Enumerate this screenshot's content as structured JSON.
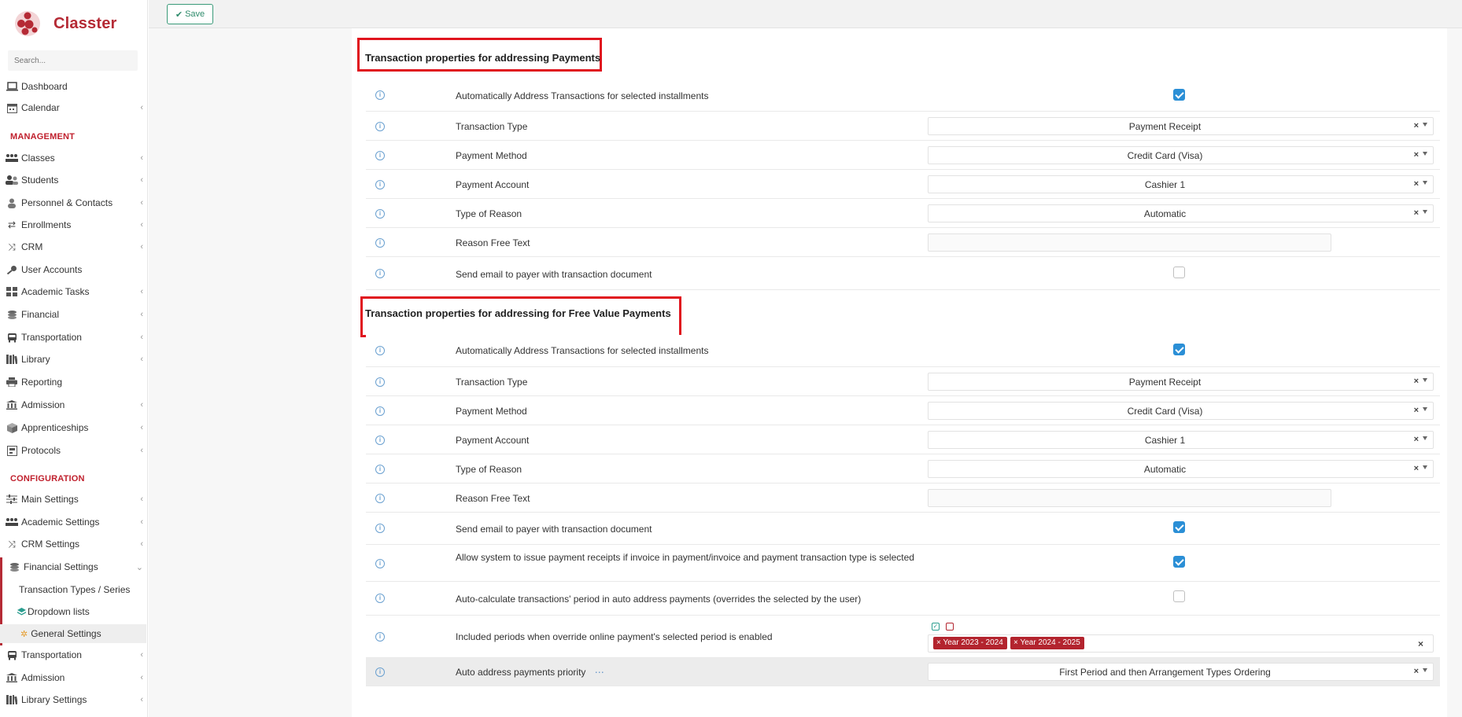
{
  "app": {
    "name": "Classter"
  },
  "sidebar": {
    "search_placeholder": "Search...",
    "items": [
      {
        "label": "Dashboard",
        "icon": "laptop-icon",
        "chevron": false
      },
      {
        "label": "Calendar",
        "icon": "calendar-icon",
        "chevron": true
      }
    ],
    "management_title": "MANAGEMENT",
    "management": [
      {
        "label": "Classes",
        "icon": "classes-icon",
        "chevron": true
      },
      {
        "label": "Students",
        "icon": "users-icon",
        "chevron": true
      },
      {
        "label": "Personnel & Contacts",
        "icon": "user-icon",
        "chevron": true
      },
      {
        "label": "Enrollments",
        "icon": "arrows-icon",
        "chevron": true
      },
      {
        "label": "CRM",
        "icon": "shuffle-icon",
        "chevron": true
      },
      {
        "label": "User Accounts",
        "icon": "key-icon",
        "chevron": false
      },
      {
        "label": "Academic Tasks",
        "icon": "grid-icon",
        "chevron": true
      },
      {
        "label": "Financial",
        "icon": "coins-icon",
        "chevron": true
      },
      {
        "label": "Transportation",
        "icon": "bus-icon",
        "chevron": true
      },
      {
        "label": "Library",
        "icon": "books-icon",
        "chevron": true
      },
      {
        "label": "Reporting",
        "icon": "printer-icon",
        "chevron": false
      },
      {
        "label": "Admission",
        "icon": "bank-icon",
        "chevron": true
      },
      {
        "label": "Apprenticeships",
        "icon": "box-icon",
        "chevron": true
      },
      {
        "label": "Protocols",
        "icon": "archive-icon",
        "chevron": true
      }
    ],
    "configuration_title": "CONFIGURATION",
    "configuration": [
      {
        "label": "Main Settings",
        "icon": "sliders-icon",
        "chevron": true
      },
      {
        "label": "Academic Settings",
        "icon": "classes-icon",
        "chevron": true
      },
      {
        "label": "CRM Settings",
        "icon": "shuffle-icon",
        "chevron": true
      },
      {
        "label": "Financial Settings",
        "icon": "coins-icon",
        "chevron": true
      }
    ],
    "financial_sub": [
      {
        "label": "Transaction Types / Series"
      },
      {
        "label": "Dropdown lists"
      },
      {
        "label": "General Settings"
      }
    ],
    "configuration_after": [
      {
        "label": "Transportation",
        "icon": "bus-icon",
        "chevron": true
      },
      {
        "label": "Admission",
        "icon": "bank-icon",
        "chevron": true
      },
      {
        "label": "Library Settings",
        "icon": "books-icon",
        "chevron": true
      }
    ]
  },
  "toolbar": {
    "save_label": "Save"
  },
  "section1": {
    "title": "Transaction properties for addressing Payments",
    "auto_address": {
      "label": "Automatically Address Transactions for selected installments",
      "checked": true
    },
    "transaction_type": {
      "label": "Transaction Type",
      "value": "Payment Receipt"
    },
    "payment_method": {
      "label": "Payment Method",
      "value": "Credit Card (Visa)"
    },
    "payment_account": {
      "label": "Payment Account",
      "value": "Cashier 1"
    },
    "type_of_reason": {
      "label": "Type of Reason",
      "value": "Automatic"
    },
    "reason_free_text": {
      "label": "Reason Free Text",
      "value": ""
    },
    "send_email": {
      "label": "Send email to payer with transaction document",
      "checked": false
    }
  },
  "section2": {
    "title": "Transaction properties for addressing for Free Value Payments",
    "auto_address": {
      "label": "Automatically Address Transactions for selected installments",
      "checked": true
    },
    "transaction_type": {
      "label": "Transaction Type",
      "value": "Payment Receipt"
    },
    "payment_method": {
      "label": "Payment Method",
      "value": "Credit Card (Visa)"
    },
    "payment_account": {
      "label": "Payment Account",
      "value": "Cashier 1"
    },
    "type_of_reason": {
      "label": "Type of Reason",
      "value": "Automatic"
    },
    "reason_free_text": {
      "label": "Reason Free Text",
      "value": ""
    },
    "send_email": {
      "label": "Send email to payer with transaction document",
      "checked": true
    },
    "allow_receipts": {
      "label": "Allow system to issue payment receipts if invoice in payment/invoice and payment transaction type is selected",
      "checked": true
    },
    "auto_calc": {
      "label": "Auto-calculate transactions' period in auto address payments (overrides the selected by the user)",
      "checked": false
    },
    "included_periods": {
      "label": "Included periods when override online payment's selected period is enabled",
      "tags": [
        "Year 2023 - 2024",
        "Year 2024 - 2025"
      ]
    },
    "priority": {
      "label": "Auto address payments priority",
      "value": "First Period and then Arrangement Types Ordering"
    }
  },
  "colors": {
    "brand": "#b52a35",
    "checkbox": "#2b8fd6",
    "highlight": "#e0141e"
  }
}
